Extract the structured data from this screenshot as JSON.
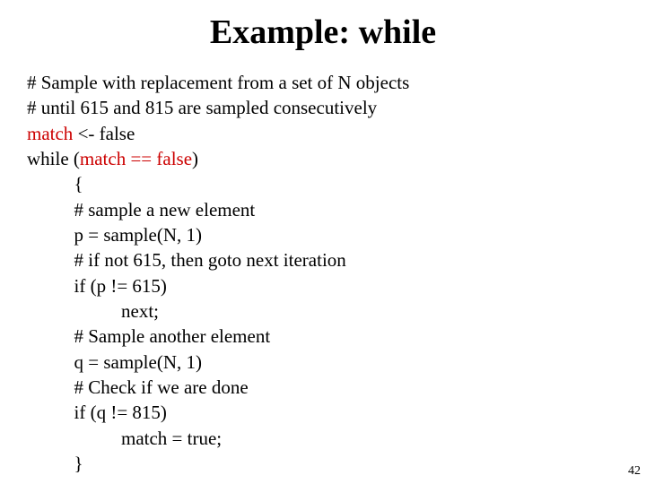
{
  "title": "Example: while",
  "code": {
    "c1": "# Sample with replacement from a set of N objects",
    "c2": "# until 615 and 815 are sampled consecutively",
    "c3a": "match",
    "c3b": " <- false",
    "c4a": "while (",
    "c4b": "match == false",
    "c4c": ")",
    "c5": "          {",
    "c6": "          # sample a new element",
    "c7": "          p = sample(N, 1)",
    "c8": "          # if not 615, then goto next iteration",
    "c9": "          if (p != 615)",
    "c10": "                    next;",
    "c11": "          # Sample another element",
    "c12": "          q = sample(N, 1)",
    "c13": "          # Check if we are done",
    "c14": "          if (q != 815)",
    "c15": "                    match = true;",
    "c16": "          }"
  },
  "page_number": "42"
}
